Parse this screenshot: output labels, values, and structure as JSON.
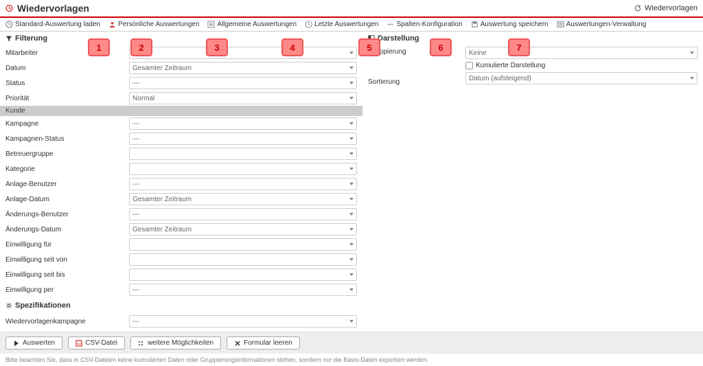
{
  "header": {
    "title": "Wiedervorlagen",
    "refresh_label": "Wiedervorlagen"
  },
  "toolbar": {
    "items": [
      {
        "label": "Standard-Auswertung laden"
      },
      {
        "label": "Persönliche Auswertungen"
      },
      {
        "label": "Allgemeine Auswertungen"
      },
      {
        "label": "Letzte Auswertungen"
      },
      {
        "label": "Spalten-Konfiguration"
      },
      {
        "label": "Auswertung speichern"
      },
      {
        "label": "Auswertungen-Verwaltung"
      }
    ]
  },
  "badges": [
    "1",
    "2",
    "3",
    "4",
    "5",
    "6",
    "7"
  ],
  "filterung": {
    "title": "Filterung",
    "rows": [
      {
        "label": "Mitarbeiter",
        "value": "---"
      },
      {
        "label": "Datum",
        "value": "Gesamter Zeitraum"
      },
      {
        "label": "Status",
        "value": "---"
      },
      {
        "label": "Priorität",
        "value": "Normal"
      }
    ],
    "kunde_label": "Kunde",
    "rows2": [
      {
        "label": "Kampagne",
        "value": "---"
      },
      {
        "label": "Kampagnen-Status",
        "value": "---"
      },
      {
        "label": "Betreuergruppe",
        "value": ""
      },
      {
        "label": "Kategorie",
        "value": ""
      },
      {
        "label": "Anlage-Benutzer",
        "value": "---"
      },
      {
        "label": "Anlage-Datum",
        "value": "Gesamter Zeitraum"
      },
      {
        "label": "Änderungs-Benutzer",
        "value": "---"
      },
      {
        "label": "Änderungs-Datum",
        "value": "Gesamter Zeitraum"
      },
      {
        "label": "Einwilligung für",
        "value": ""
      },
      {
        "label": "Einwilligung seit von",
        "value": ""
      },
      {
        "label": "Einwilligung seit bis",
        "value": ""
      },
      {
        "label": "Einwilligung per",
        "value": "---"
      }
    ]
  },
  "spezifikationen": {
    "title": "Spezifikationen",
    "rows": [
      {
        "label": "Wiedervorlagenkampagne",
        "value": "---"
      }
    ]
  },
  "darstellung": {
    "title": "Darstellung",
    "gruppierung_label": "Gruppierung",
    "gruppierung_value": "Keine",
    "kumuliert_label": "Kumulierte Darstellung",
    "sortierung_label": "Sortierung",
    "sortierung_value": "Datum (aufsteigend)"
  },
  "buttons": {
    "auswerten": "Auswerten",
    "csv": "CSV-Datei",
    "weitere": "weitere Möglichkeiten",
    "leeren": "Formular leeren"
  },
  "footer": "Bitte beachten Sie, dass in CSV-Dateien keine kumulierten Daten oder Gruppierungsinformationen stehen, sondern nur die Basis-Daten exportiert werden."
}
